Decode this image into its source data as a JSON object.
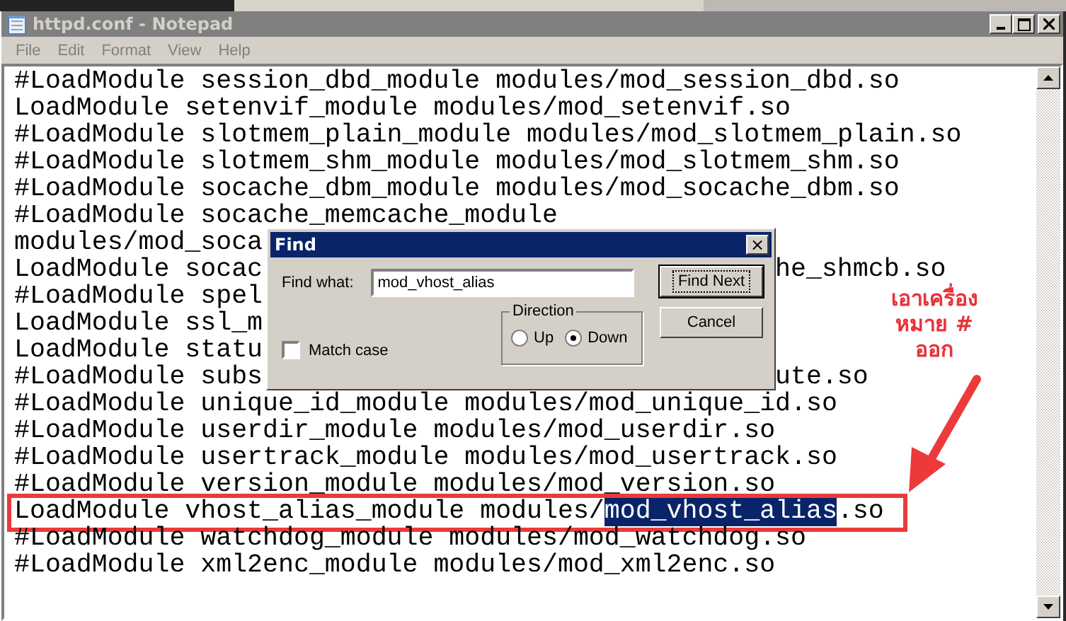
{
  "window": {
    "title": "httpd.conf - Notepad"
  },
  "menu": [
    "File",
    "Edit",
    "Format",
    "View",
    "Help"
  ],
  "lines": [
    {
      "kind": "plain",
      "text": "#LoadModule session_dbd_module modules/mod_session_dbd.so",
      "boxed": false
    },
    {
      "kind": "plain",
      "text": "LoadModule setenvif_module modules/mod_setenvif.so",
      "boxed": false
    },
    {
      "kind": "plain",
      "text": "#LoadModule slotmem_plain_module modules/mod_slotmem_plain.so",
      "boxed": false
    },
    {
      "kind": "plain",
      "text": "#LoadModule slotmem_shm_module modules/mod_slotmem_shm.so",
      "boxed": false
    },
    {
      "kind": "plain",
      "text": "#LoadModule socache_dbm_module modules/mod_socache_dbm.so",
      "boxed": false
    },
    {
      "kind": "plain",
      "text": "#LoadModule socache_memcache_module",
      "boxed": false
    },
    {
      "kind": "plain",
      "text": "modules/mod_soca",
      "boxed": false
    },
    {
      "kind": "covered",
      "text": "LoadModule socac",
      "tail": "he_shmcb.so",
      "boxed": false
    },
    {
      "kind": "plain",
      "text": "#LoadModule spel",
      "boxed": false
    },
    {
      "kind": "plain",
      "text": "LoadModule ssl_m",
      "boxed": false
    },
    {
      "kind": "plain",
      "text": "LoadModule statu",
      "boxed": false
    },
    {
      "kind": "covered",
      "text": "#LoadModule subs",
      "tail": "ute.so",
      "boxed": false
    },
    {
      "kind": "plain",
      "text": "#LoadModule unique_id_module modules/mod_unique_id.so",
      "boxed": false
    },
    {
      "kind": "plain",
      "text": "#LoadModule userdir_module modules/mod_userdir.so",
      "boxed": false
    },
    {
      "kind": "plain",
      "text": "#LoadModule usertrack_module modules/mod_usertrack.so",
      "boxed": false
    },
    {
      "kind": "plain",
      "text": "#LoadModule version_module modules/mod_version.so",
      "boxed": false
    },
    {
      "kind": "match",
      "text": "LoadModule vhost_alias_module modules/",
      "selection": "mod_vhost_alias",
      "after": ".so",
      "boxed": true
    },
    {
      "kind": "plain",
      "text": "#LoadModule watchdog_module modules/mod_watchdog.so",
      "boxed": false
    },
    {
      "kind": "plain",
      "text": "#LoadModule xml2enc_module modules/mod_xml2enc.so",
      "boxed": false
    }
  ],
  "annotation": {
    "lines": [
      "เอาเครื่อง",
      "หมาย #",
      "ออก"
    ]
  },
  "find_dialog": {
    "title": "Find",
    "close": "×",
    "label": "Find what:",
    "value": "mod_vhost_alias",
    "find_next": "Find Next",
    "cancel": "Cancel",
    "direction": {
      "title": "Direction",
      "options": [
        {
          "label": "Up",
          "selected": false
        },
        {
          "label": "Down",
          "selected": true
        }
      ]
    },
    "match_case": {
      "label": "Match case",
      "checked": false
    }
  }
}
